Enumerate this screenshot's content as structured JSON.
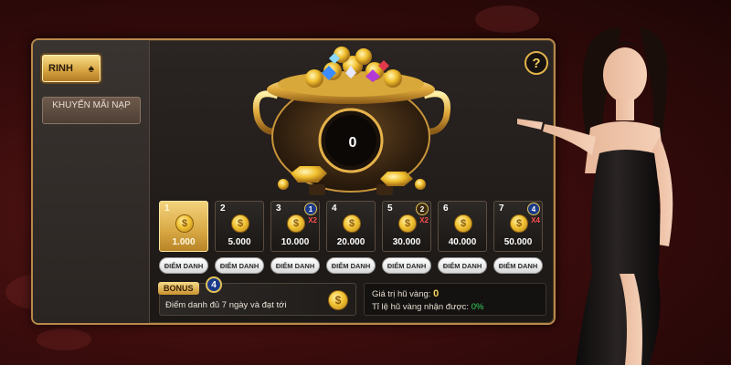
{
  "sidebar": {
    "tab_rinh": "RINH",
    "tab_rinh_icon": "spade-icon",
    "tab_khuyen_mai": "KHUYẾN MÃI NẠP"
  },
  "help": {
    "label": "?"
  },
  "jackpot": {
    "value": "0"
  },
  "days": [
    {
      "num": "1",
      "amount": "1.000",
      "active": true,
      "badge": "",
      "mult": ""
    },
    {
      "num": "2",
      "amount": "5.000",
      "active": false,
      "badge": "",
      "mult": ""
    },
    {
      "num": "3",
      "amount": "10.000",
      "active": false,
      "badge": "1",
      "mult": "X2"
    },
    {
      "num": "4",
      "amount": "20.000",
      "active": false,
      "badge": "",
      "mult": ""
    },
    {
      "num": "5",
      "amount": "30.000",
      "active": false,
      "badge": "2",
      "mult": "X2"
    },
    {
      "num": "6",
      "amount": "40.000",
      "active": false,
      "badge": "",
      "mult": ""
    },
    {
      "num": "7",
      "amount": "50.000",
      "active": false,
      "badge": "4",
      "mult": "X4"
    }
  ],
  "checkin_label": "ĐIỂM DANH",
  "coin_symbol": "$",
  "bonus": {
    "tag": "BONUS",
    "badge": "4",
    "text": "Điểm danh đủ 7 ngày và đạt tới"
  },
  "stats": {
    "pot_value_label": "Giá trị hũ vàng:",
    "pot_value": "0",
    "ratio_label": "Tỉ lệ hũ vàng nhận được:",
    "ratio_value": "0%"
  },
  "colors": {
    "accent_gold": "#d9a844",
    "frame_gold": "#b8894a",
    "bonus_green": "#34d35a"
  }
}
